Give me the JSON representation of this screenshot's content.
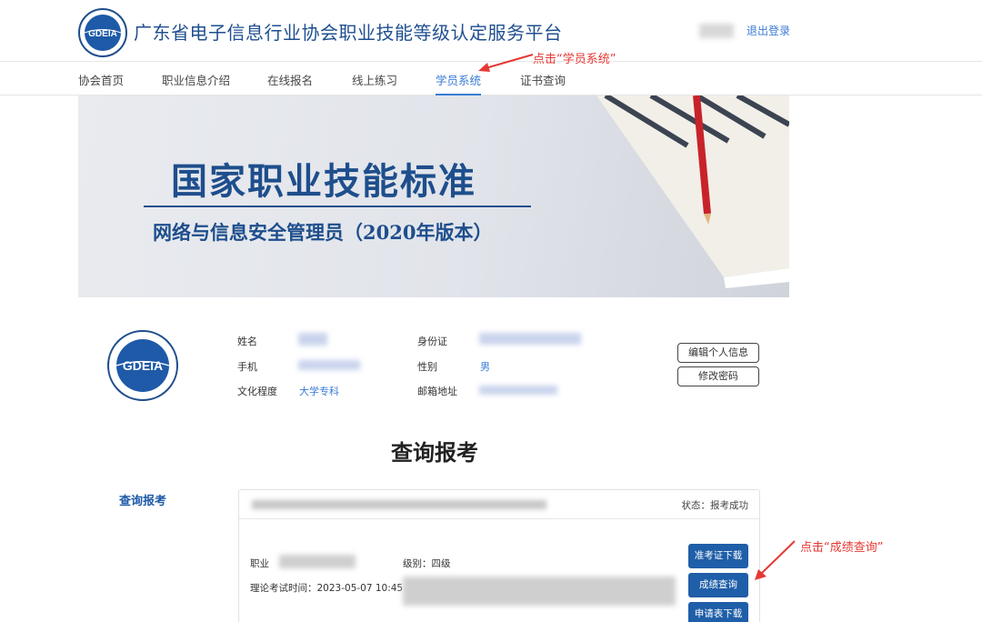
{
  "header": {
    "site_title": "广东省电子信息行业协会职业技能等级认定服务平台",
    "logo_text": "GDEIA",
    "logout": "退出登录"
  },
  "nav": {
    "items": [
      {
        "label": "协会首页"
      },
      {
        "label": "职业信息介绍"
      },
      {
        "label": "在线报名"
      },
      {
        "label": "线上练习"
      },
      {
        "label": "学员系统",
        "active": true
      },
      {
        "label": "证书查询"
      }
    ]
  },
  "annotations": {
    "nav_hint": "点击“学员系统”",
    "score_hint": "点击“成绩查询”",
    "color": "#e53935"
  },
  "banner": {
    "title": "国家职业技能标准",
    "subtitle": "网络与信息安全管理员（2020年版本）"
  },
  "profile": {
    "name_label": "姓名",
    "phone_label": "手机",
    "education_label": "文化程度",
    "education_value": "大学专科",
    "id_label": "身份证",
    "gender_label": "性别",
    "gender_value": "男",
    "email_label": "邮箱地址",
    "edit_button": "编辑个人信息",
    "password_button": "修改密码"
  },
  "section_title": "查询报考",
  "sidebar_link": "查询报考",
  "exam_card": {
    "status": "状态：报考成功",
    "occupation_label": "职业",
    "level": "级别：四级",
    "theory_time": "理论考试时间：2023-05-07 10:45",
    "buttons": {
      "admission": "准考证下载",
      "score": "成绩查询",
      "application": "申请表下载"
    }
  },
  "colors": {
    "brand_blue": "#1e4e8c",
    "link_blue": "#3a7bd5",
    "button_blue": "#1f5ea8"
  }
}
